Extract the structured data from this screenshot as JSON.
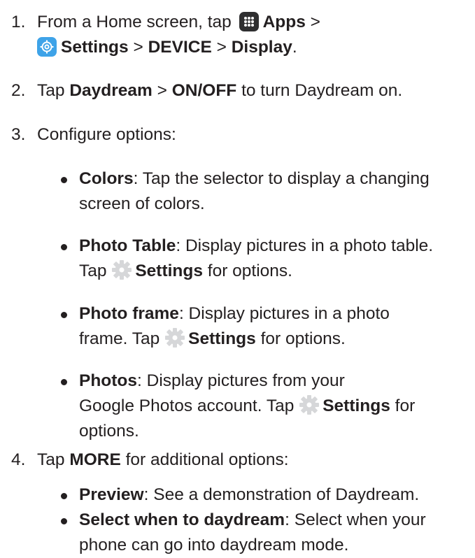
{
  "steps": [
    {
      "num": "1.",
      "text_a": "From a Home screen, tap",
      "apps": "Apps",
      "sep1": " >",
      "settings": "Settings",
      "sep2": " > ",
      "device": "DEVICE",
      "sep3": " > ",
      "display": "Display",
      "end": "."
    },
    {
      "num": "2.",
      "a": "Tap ",
      "daydream": "Daydream",
      "sep": " > ",
      "onoff": "ON/OFF",
      "b": " to turn Daydream on."
    },
    {
      "num": "3.",
      "text": "Configure options:"
    },
    {
      "num": "4.",
      "a": "Tap ",
      "more": "MORE",
      "b": " for additional options:"
    }
  ],
  "options": [
    {
      "term": "Colors",
      "line1": ": Tap the selector to display a changing",
      "line2": "screen of colors."
    },
    {
      "term": "Photo Table",
      "line1": ": Display pictures in a photo table.",
      "line2_pre": "Tap ",
      "settings": "Settings",
      "line2_post": " for options."
    },
    {
      "term": "Photo frame",
      "line1": ": Display pictures in a photo",
      "line2_pre": "frame. Tap ",
      "settings": "Settings",
      "line2_post": " for options."
    },
    {
      "term": "Photos",
      "line1": ": Display pictures from your",
      "line2_pre": "Google Photos account. Tap ",
      "settings": "Settings",
      "line2_post": " for",
      "line3": "options."
    }
  ],
  "more_options": [
    {
      "term": "Preview",
      "line1": ": See a demonstration of Daydream."
    },
    {
      "term": "Select when to daydream",
      "line1": ": Select when your",
      "line2": "phone can go into daydream mode."
    }
  ],
  "icon_names": {
    "apps": "apps-icon",
    "settings_app": "settings-app-icon",
    "settings_gear": "gear-icon"
  },
  "colors": {
    "text": "#231f20",
    "settings_app_icon": "#3ea3e8",
    "apps_icon": "#2f2f30",
    "gear_icon": "#d6d7d9"
  }
}
